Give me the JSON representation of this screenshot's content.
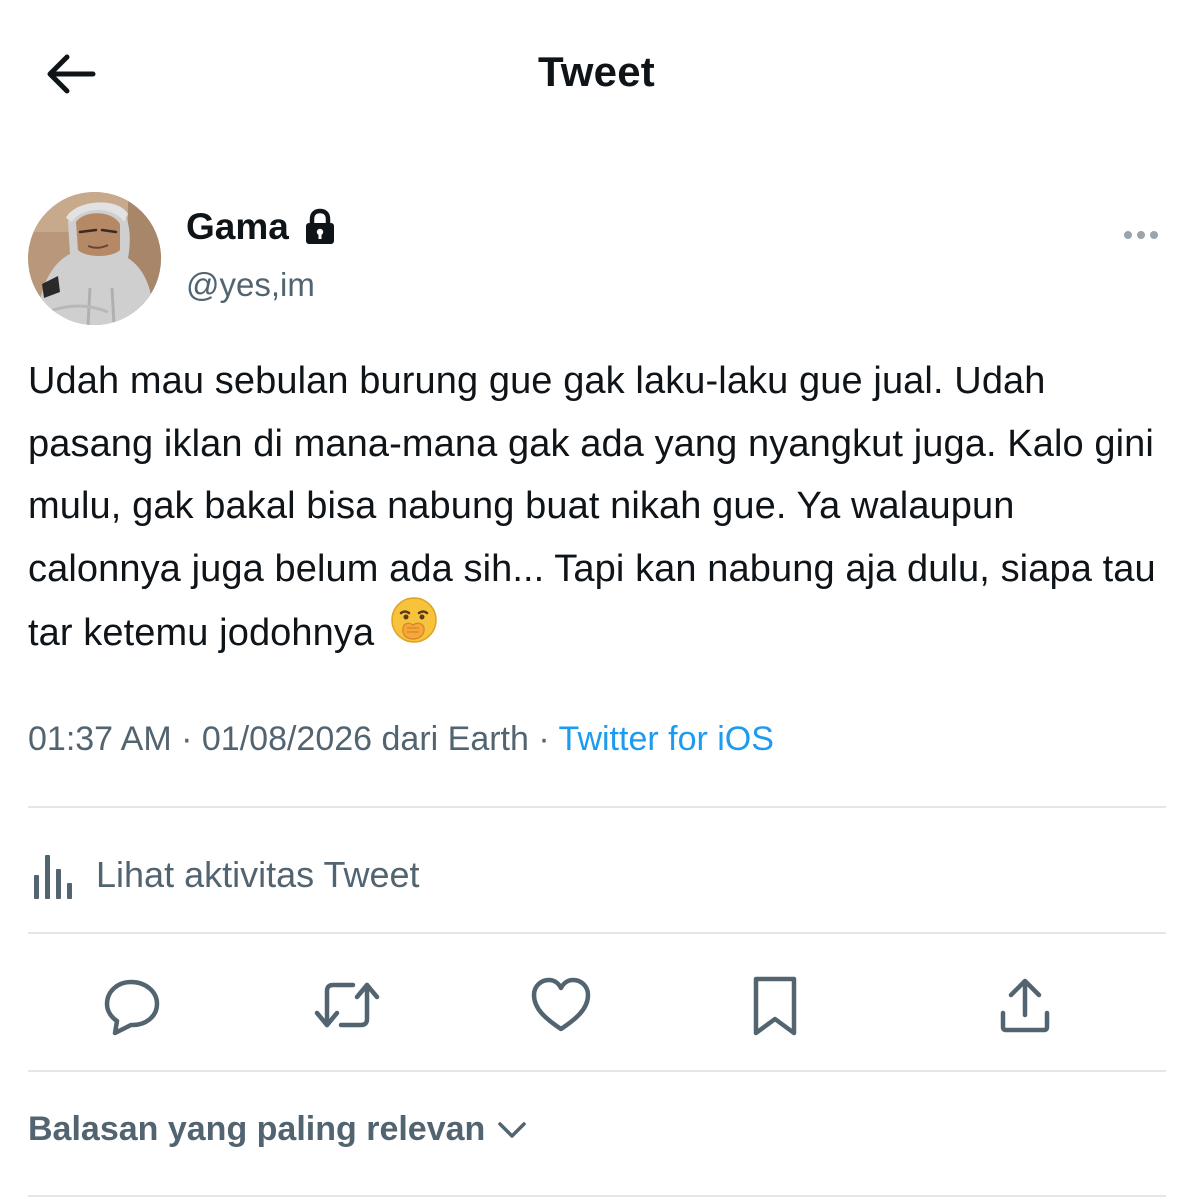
{
  "header": {
    "title": "Tweet",
    "back_icon": "arrow-left-icon"
  },
  "author": {
    "display_name": "Gama",
    "handle": "@yes,im",
    "protected_icon": "lock-icon",
    "more_icon": "more-dots-icon"
  },
  "tweet": {
    "text": "Udah mau sebulan burung gue gak laku-laku gue jual. Udah pasang iklan di mana-mana gak ada yang nyangkut juga. Kalo gini mulu, gak bakal bisa nabung buat nikah gue. Ya walaupun calonnya juga belum ada sih... Tapi kan nabung aja dulu, siapa tau tar ketemu jodohnya",
    "emoji": "face-with-hand-over-mouth-emoji",
    "time": "01:37 AM",
    "separator": "·",
    "date_location": "01/08/2026 dari Earth",
    "source": "Twitter for iOS"
  },
  "activity": {
    "label": "Lihat aktivitas Tweet",
    "icon": "analytics-icon"
  },
  "actions": [
    {
      "icon": "reply-icon"
    },
    {
      "icon": "retweet-icon"
    },
    {
      "icon": "like-icon"
    },
    {
      "icon": "bookmark-icon"
    },
    {
      "icon": "share-icon"
    }
  ],
  "replies": {
    "sort_label": "Balasan yang paling relevan",
    "chevron_icon": "chevron-down-icon"
  },
  "colors": {
    "accent": "#1d9bf0",
    "secondary_text": "#536471",
    "primary_text": "#0f1419",
    "divider": "#e3e7ea"
  }
}
